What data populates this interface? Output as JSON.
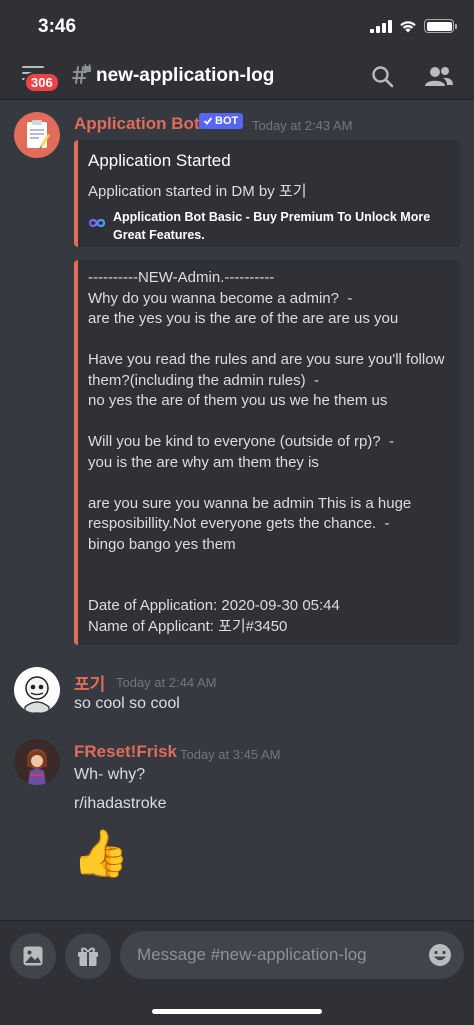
{
  "status_bar": {
    "time": "3:46"
  },
  "header": {
    "badge_count": "306",
    "channel_name": "new-application-log",
    "icons": [
      "menu-icon",
      "locked-channel-icon",
      "search-icon",
      "members-icon"
    ]
  },
  "colors": {
    "bot_name": "#e16c5a",
    "embed_accent": "#e16c5a",
    "bot_tag": "#5865f2",
    "background": "#36393f"
  },
  "messages": [
    {
      "author": "Application Bot",
      "bot_tag": "BOT",
      "timestamp": "Today at 2:43 AM",
      "avatar_icon": "clipboard-icon",
      "embed1": {
        "title": "Application Started",
        "description": "Application started in DM by 포기",
        "footer_icon": "infinity-logo-icon",
        "footer": "Application Bot Basic - Buy Premium To Unlock More Great Features."
      },
      "embed2": {
        "body": "----------NEW-Admin.----------\nWhy do you wanna become a admin?  -\nare the yes you is the are of the are are us you\n\nHave you read the rules and are you sure you'll follow them?(including the admin rules)  -\nno yes the are of them you us we he them us\n\nWill you be kind to everyone (outside of rp)?  -\nyou is the are why am them they is\n\nare you sure you wanna be admin This is a huge resposibillity.Not everyone gets the chance.  -\nbingo bango yes them\n\n\nDate of Application: 2020-09-30 05:44\nName of Applicant: 포기#3450"
      }
    },
    {
      "author": "포기",
      "timestamp": "Today at 2:44 AM",
      "avatar_icon": "sans-avatar-icon",
      "lines": [
        "so cool so cool"
      ]
    },
    {
      "author": "FReset!Frisk",
      "timestamp": "Today at 3:45 AM",
      "avatar_icon": "frisk-avatar-icon",
      "lines": [
        "Wh- why?",
        "r/ihadastroke"
      ],
      "emoji": "👍"
    }
  ],
  "composer": {
    "placeholder": "Message #new-application-log",
    "icons": [
      "image-icon",
      "gift-icon",
      "emoji-icon"
    ]
  }
}
